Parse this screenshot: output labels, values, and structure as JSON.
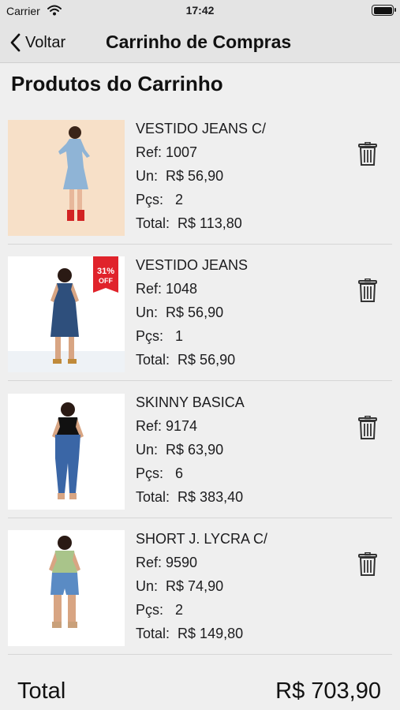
{
  "status": {
    "carrier": "Carrier",
    "time": "17:42"
  },
  "nav": {
    "back_label": "Voltar",
    "title": "Carrinho de Compras"
  },
  "section_title": "Produtos do Carrinho",
  "items": [
    {
      "name": "VESTIDO JEANS C/",
      "ref": "Ref: 1007",
      "unit_label": "Un:",
      "unit_price": "R$ 56,90",
      "qty_label": "Pçs:",
      "qty": "2",
      "total_label": "Total:",
      "total": "R$ 113,80",
      "badge": ""
    },
    {
      "name": "VESTIDO JEANS",
      "ref": "Ref: 1048",
      "unit_label": "Un:",
      "unit_price": "R$ 56,90",
      "qty_label": "Pçs:",
      "qty": "1",
      "total_label": "Total:",
      "total": "R$ 56,90",
      "badge": "31% OFF"
    },
    {
      "name": "SKINNY BASICA",
      "ref": "Ref: 9174",
      "unit_label": "Un:",
      "unit_price": "R$ 63,90",
      "qty_label": "Pçs:",
      "qty": "6",
      "total_label": "Total:",
      "total": "R$ 383,40",
      "badge": ""
    },
    {
      "name": "SHORT J. LYCRA C/",
      "ref": "Ref: 9590",
      "unit_label": "Un:",
      "unit_price": "R$ 74,90",
      "qty_label": "Pçs:",
      "qty": "2",
      "total_label": "Total:",
      "total": "R$ 149,80",
      "badge": ""
    }
  ],
  "footer": {
    "total_label": "Total",
    "total_value": "R$ 703,90"
  },
  "colors": {
    "background": "#efefef",
    "bar": "#e4e4e4",
    "badge": "#e0232b"
  }
}
